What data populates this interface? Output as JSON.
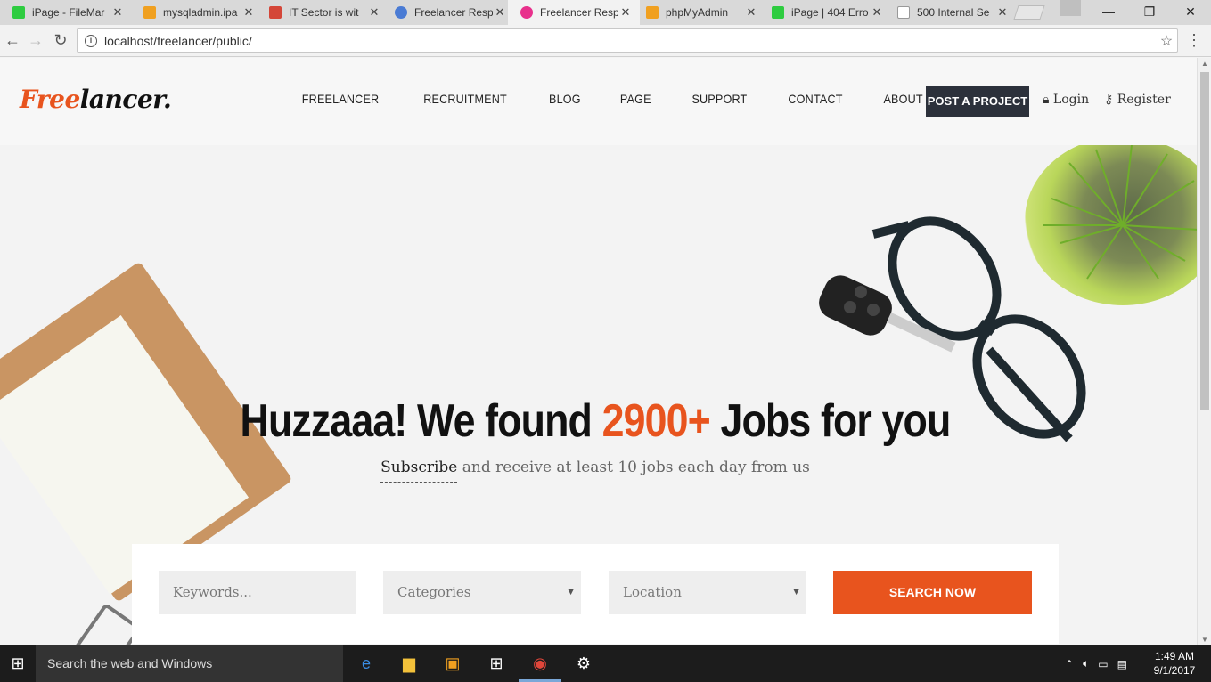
{
  "browser": {
    "tabs": [
      {
        "label": "iPage - FileMar",
        "icon": "ipage-icon",
        "color": "#2ecc40"
      },
      {
        "label": "mysqladmin.ipa",
        "icon": "pma-icon",
        "color": "#f0a020"
      },
      {
        "label": "IT Sector is wit",
        "icon": "gmail-icon",
        "color": "#d44638"
      },
      {
        "label": "Freelancer Resp",
        "icon": "freelancer-icon",
        "color": "#4a7bd4"
      },
      {
        "label": "Freelancer Resp",
        "icon": "freelancer-pink-icon",
        "color": "#e8308c"
      },
      {
        "label": "phpMyAdmin",
        "icon": "pma-icon",
        "color": "#f0a020"
      },
      {
        "label": "iPage | 404 Erro",
        "icon": "ipage-icon",
        "color": "#2ecc40"
      },
      {
        "label": "500 Internal Se",
        "icon": "page-icon",
        "color": "#bbbbbb"
      }
    ],
    "close_glyph": "✕",
    "url": "localhost/freelancer/public/"
  },
  "site": {
    "logo_a": "Free",
    "logo_b": "lancer.",
    "nav": [
      "FREELANCER",
      "RECRUITMENT",
      "BLOG",
      "PAGE",
      "SUPPORT",
      "CONTACT",
      "ABOUT"
    ],
    "post_project": "POST A PROJECT",
    "login": "Login",
    "register": "Register"
  },
  "hero": {
    "headline_pre": "Huzzaaa! We found ",
    "headline_count": "2900+",
    "headline_post": " Jobs for you",
    "subscribe": "Subscribe",
    "subline_rest": " and receive at least 10 jobs each day from us"
  },
  "search": {
    "keywords_placeholder": "Keywords...",
    "categories": "Categories",
    "location": "Location",
    "button": "SEARCH NOW"
  },
  "taskbar": {
    "search_placeholder": "Search the web and Windows",
    "time": "1:49 AM",
    "date": "9/1/2017"
  },
  "colors": {
    "accent": "#e8541e",
    "dark_button": "#2c313b"
  }
}
